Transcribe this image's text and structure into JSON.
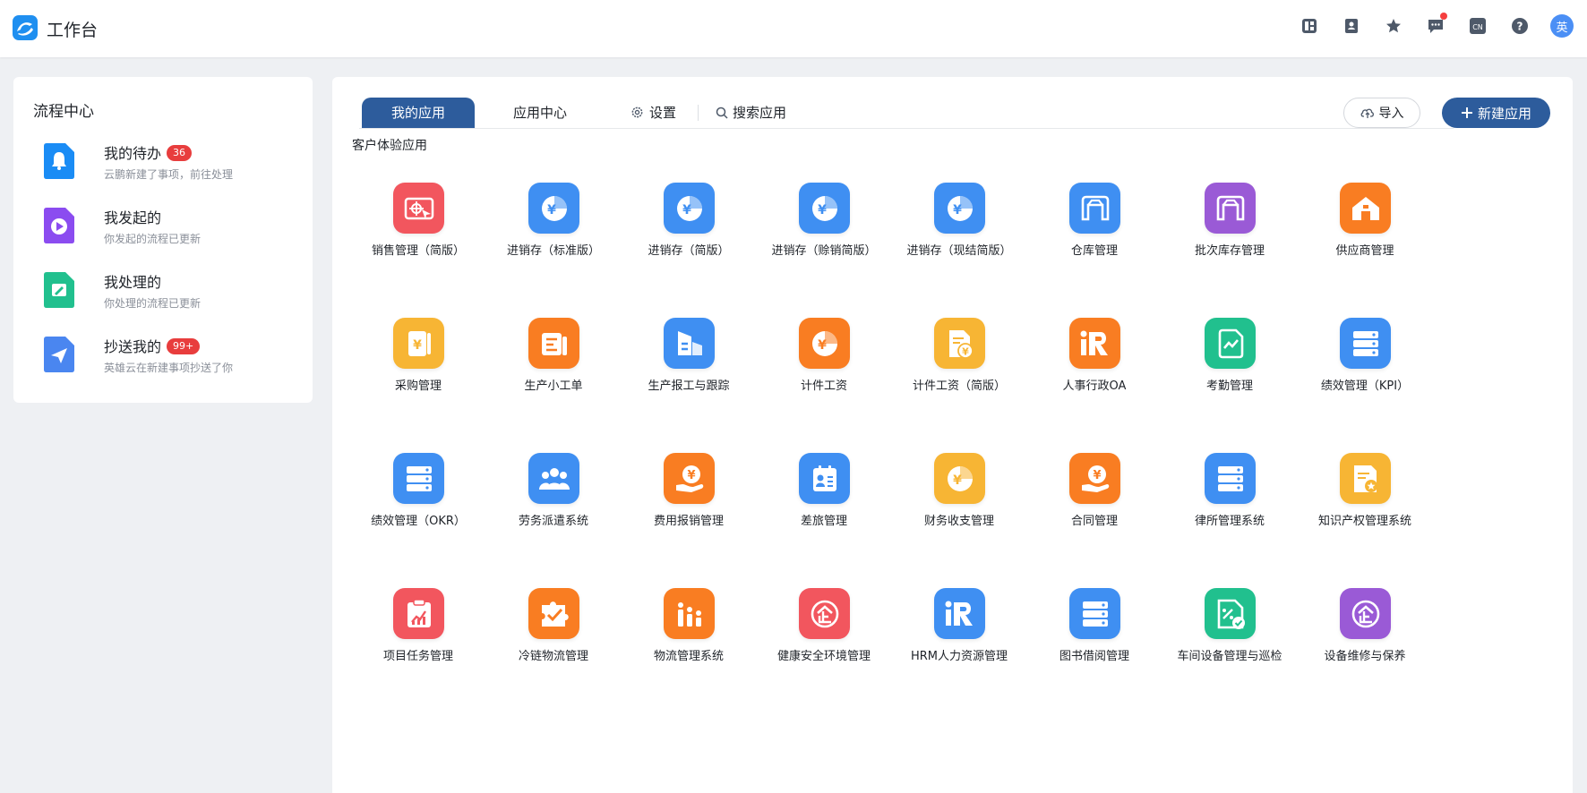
{
  "header": {
    "title": "工作台",
    "lang_label": "CN",
    "avatar_text": "英"
  },
  "workflow": {
    "title": "流程中心",
    "items": [
      {
        "name": "我的待办",
        "badge": "36",
        "desc": "云鹏新建了事项，前往处理",
        "color": "#1a8cf5",
        "icon": "bell-icon"
      },
      {
        "name": "我发起的",
        "badge": "",
        "desc": "你发起的流程已更新",
        "color": "#8b4cf0",
        "icon": "play-icon"
      },
      {
        "name": "我处理的",
        "badge": "",
        "desc": "你处理的流程已更新",
        "color": "#21c08e",
        "icon": "edit-icon"
      },
      {
        "name": "抄送我的",
        "badge": "99+",
        "desc": "英雄云在新建事项抄送了你",
        "color": "#4a86f0",
        "icon": "send-icon"
      }
    ]
  },
  "tabs": {
    "my_apps": "我的应用",
    "app_center": "应用中心",
    "settings": "设置",
    "search": "搜索应用",
    "import": "导入",
    "new_app": "新建应用"
  },
  "section": {
    "title": "客户体验应用"
  },
  "apps": [
    {
      "name": "销售管理（简版）",
      "color": "#f2565e",
      "icon": "target-icon"
    },
    {
      "name": "进销存（标准版）",
      "color": "#3f8ff2",
      "icon": "yuan-pie-icon"
    },
    {
      "name": "进销存（简版）",
      "color": "#3f8ff2",
      "icon": "yuan-pie-icon"
    },
    {
      "name": "进销存（赊销简版）",
      "color": "#3f8ff2",
      "icon": "yuan-pie-icon"
    },
    {
      "name": "进销存（现结简版）",
      "color": "#3f8ff2",
      "icon": "yuan-pie-icon"
    },
    {
      "name": "仓库管理",
      "color": "#3f8ff2",
      "icon": "warehouse-icon"
    },
    {
      "name": "批次库存管理",
      "color": "#9a5ad6",
      "icon": "warehouse-icon"
    },
    {
      "name": "供应商管理",
      "color": "#f97d22",
      "icon": "house-icon"
    },
    {
      "name": "采购管理",
      "color": "#f7b534",
      "icon": "receipt-icon"
    },
    {
      "name": "生产小工单",
      "color": "#f97d22",
      "icon": "workorder-icon"
    },
    {
      "name": "生产报工与跟踪",
      "color": "#3f8ff2",
      "icon": "factory-icon"
    },
    {
      "name": "计件工资",
      "color": "#f97d22",
      "icon": "yuan-pie-icon"
    },
    {
      "name": "计件工资（简版）",
      "color": "#f7b534",
      "icon": "doc-yuan-icon"
    },
    {
      "name": "人事行政OA",
      "color": "#f97d22",
      "icon": "ir-icon"
    },
    {
      "name": "考勤管理",
      "color": "#21c08e",
      "icon": "chart-doc-icon"
    },
    {
      "name": "绩效管理（KPI）",
      "color": "#3f8ff2",
      "icon": "server-icon"
    },
    {
      "name": "绩效管理（OKR）",
      "color": "#3f8ff2",
      "icon": "server-icon"
    },
    {
      "name": "劳务派遣系统",
      "color": "#3f8ff2",
      "icon": "people-icon"
    },
    {
      "name": "费用报销管理",
      "color": "#f97d22",
      "icon": "hand-yuan-icon"
    },
    {
      "name": "差旅管理",
      "color": "#3f8ff2",
      "icon": "badge-card-icon"
    },
    {
      "name": "财务收支管理",
      "color": "#f7b534",
      "icon": "yuan-pie-icon"
    },
    {
      "name": "合同管理",
      "color": "#f97d22",
      "icon": "hand-yuan-icon"
    },
    {
      "name": "律所管理系统",
      "color": "#3f8ff2",
      "icon": "server-icon"
    },
    {
      "name": "知识产权管理系统",
      "color": "#f7b534",
      "icon": "doc-star-icon"
    },
    {
      "name": "项目任务管理",
      "color": "#f2565e",
      "icon": "clipboard-icon"
    },
    {
      "name": "冷链物流管理",
      "color": "#f97d22",
      "icon": "puzzle-check-icon"
    },
    {
      "name": "物流管理系统",
      "color": "#f97d22",
      "icon": "bars-people-icon"
    },
    {
      "name": "健康安全环境管理",
      "color": "#f2565e",
      "icon": "qi-icon"
    },
    {
      "name": "HRM人力资源管理",
      "color": "#3f8ff2",
      "icon": "ir-icon"
    },
    {
      "name": "图书借阅管理",
      "color": "#3f8ff2",
      "icon": "server-icon"
    },
    {
      "name": "车间设备管理与巡检",
      "color": "#21c08e",
      "icon": "percent-doc-icon"
    },
    {
      "name": "设备维修与保养",
      "color": "#9a5ad6",
      "icon": "qi-icon"
    }
  ]
}
